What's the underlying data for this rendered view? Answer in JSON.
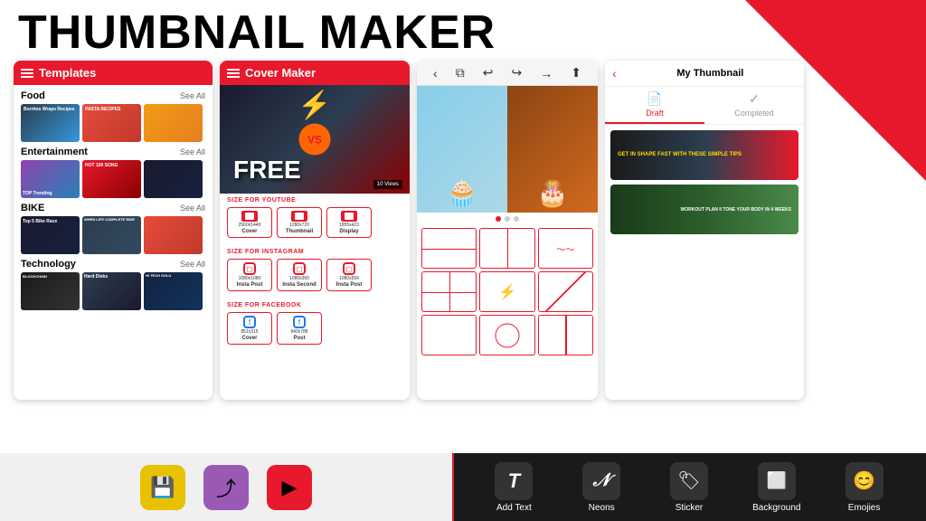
{
  "app": {
    "title": "THUMBNAIL MAKER"
  },
  "phone1": {
    "header": "Templates",
    "categories": [
      {
        "name": "Food",
        "seeAll": "See All",
        "thumbs": [
          "food-1",
          "food-2",
          "food-3"
        ]
      },
      {
        "name": "Entertainment",
        "seeAll": "See All",
        "thumbs": [
          "ent-1",
          "ent-2",
          "ent-3"
        ]
      },
      {
        "name": "BIKE",
        "seeAll": "See All",
        "thumbs": [
          "bike-1",
          "bike-2",
          "bike-3"
        ]
      },
      {
        "name": "Technology",
        "seeAll": "See All",
        "thumbs": [
          "tech-1",
          "tech-2",
          "tech-3"
        ]
      }
    ]
  },
  "phone2": {
    "header": "Cover Maker",
    "sections": [
      {
        "label": "SIZE FOR YOUTUBE",
        "items": [
          {
            "size": "2560x1440",
            "name": "Cover"
          },
          {
            "size": "1280x720",
            "name": "Thumbnail"
          },
          {
            "size": "1855x423",
            "name": "Display"
          }
        ]
      },
      {
        "label": "SIZE FOR INSTAGRAM",
        "items": [
          {
            "size": "1080x1080",
            "name": "Insta Post"
          },
          {
            "size": "1080x350",
            "name": "Insta Second"
          },
          {
            "size": "1080x556",
            "name": "Insta Post"
          }
        ]
      },
      {
        "label": "SIZE FOR FACEBOOK",
        "items": []
      }
    ]
  },
  "phone3": {
    "toolbar": [
      "layers",
      "undo",
      "redo",
      "export"
    ],
    "dots": [
      true,
      false,
      false
    ]
  },
  "phone4": {
    "header": "My Thumbnail",
    "tabs": [
      {
        "name": "Draft",
        "icon": "📄"
      },
      {
        "name": "Completed",
        "icon": "✓"
      }
    ]
  },
  "bottomLeft": {
    "buttons": [
      {
        "label": "Save",
        "type": "save"
      },
      {
        "label": "Share",
        "type": "share"
      },
      {
        "label": "YouTube",
        "type": "yt"
      }
    ]
  },
  "bottomRight": {
    "tools": [
      {
        "label": "Add Text",
        "icon": "T"
      },
      {
        "label": "Neons",
        "icon": "N"
      },
      {
        "label": "Sticker",
        "icon": "🏷"
      },
      {
        "label": "Background",
        "icon": "⬜"
      },
      {
        "label": "Emojies",
        "icon": "😊"
      }
    ]
  }
}
